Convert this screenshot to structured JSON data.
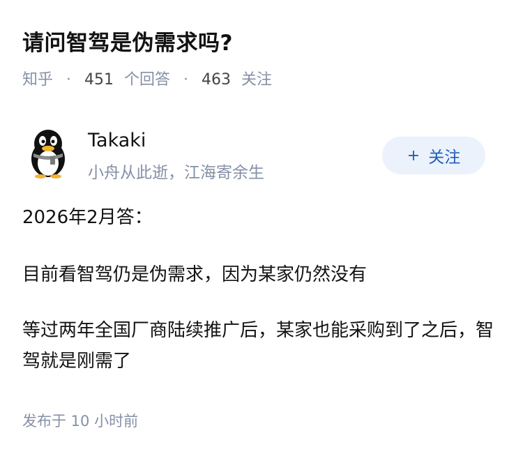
{
  "question": {
    "title": "请问智驾是伪需求吗?",
    "source": "知乎",
    "answer_count": "451",
    "answer_label": "个回答",
    "follow_count": "463",
    "follow_label": "关注",
    "separator": "·"
  },
  "author": {
    "name": "Takaki",
    "bio": "小舟从此逝，江海寄余生",
    "avatar_icon": "penguin-avatar-icon",
    "follow_button_plus": "+",
    "follow_button_label": "关注"
  },
  "answer": {
    "paragraphs": [
      "2026年2月答：",
      "目前看智驾仍是伪需求，因为某家仍然没有",
      "等过两年全国厂商陆续推广后，某家也能采购到了之后，智驾就是刚需了"
    ]
  },
  "footer": {
    "publish_time": "发布于  10 小时前"
  },
  "colors": {
    "meta_gray": "#8590a6",
    "follow_button_bg": "#ebf2fb",
    "follow_button_text": "#1e5dbf",
    "title_text": "#121212"
  }
}
